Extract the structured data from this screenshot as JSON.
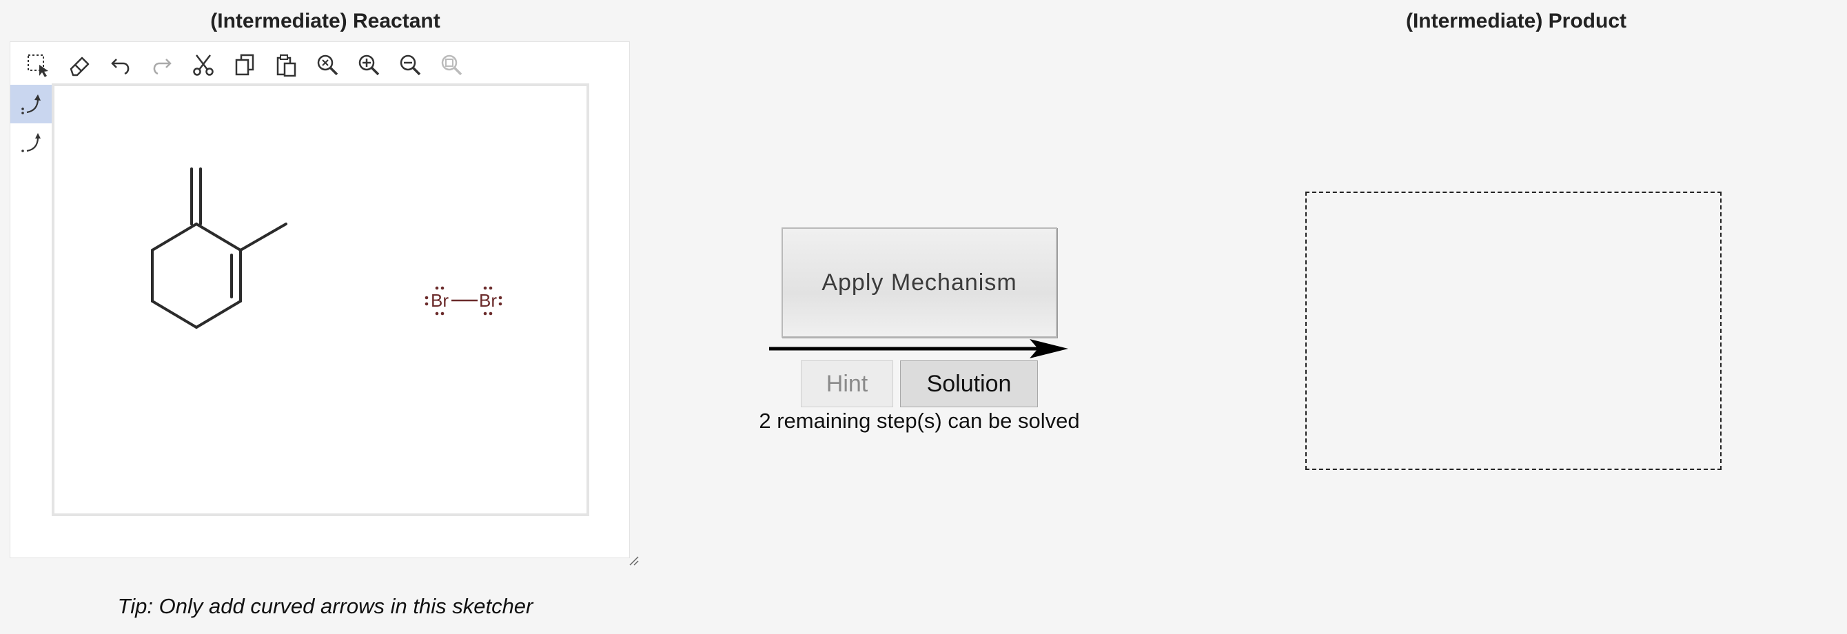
{
  "reactant_panel": {
    "title": "(Intermediate) Reactant",
    "toolbar": [
      {
        "name": "select-icon"
      },
      {
        "name": "eraser-icon"
      },
      {
        "name": "undo-icon"
      },
      {
        "name": "redo-icon"
      },
      {
        "name": "cut-icon"
      },
      {
        "name": "copy-icon"
      },
      {
        "name": "paste-icon"
      },
      {
        "name": "zoom-reset-icon"
      },
      {
        "name": "zoom-in-icon"
      },
      {
        "name": "zoom-out-icon"
      },
      {
        "name": "zoom-fit-icon"
      }
    ],
    "side_tools": [
      {
        "name": "electron-pair-arrow-icon",
        "active": true
      },
      {
        "name": "single-electron-arrow-icon",
        "active": false
      }
    ],
    "molecules": {
      "bromine": {
        "atom1": "Br",
        "atom2": "Br",
        "color": "#6b2b2b"
      }
    },
    "tip": "Tip: Only add curved arrows in this sketcher"
  },
  "middle": {
    "apply_label": "Apply Mechanism",
    "hint_label": "Hint",
    "solution_label": "Solution",
    "remaining_text": "2 remaining step(s) can be solved"
  },
  "product_panel": {
    "title": "(Intermediate) Product"
  },
  "colors": {
    "background": "#f5f5f5",
    "active_tool": "#c9d6ef",
    "bond": "#2b2b2b",
    "bromine": "#6b2b2b"
  }
}
